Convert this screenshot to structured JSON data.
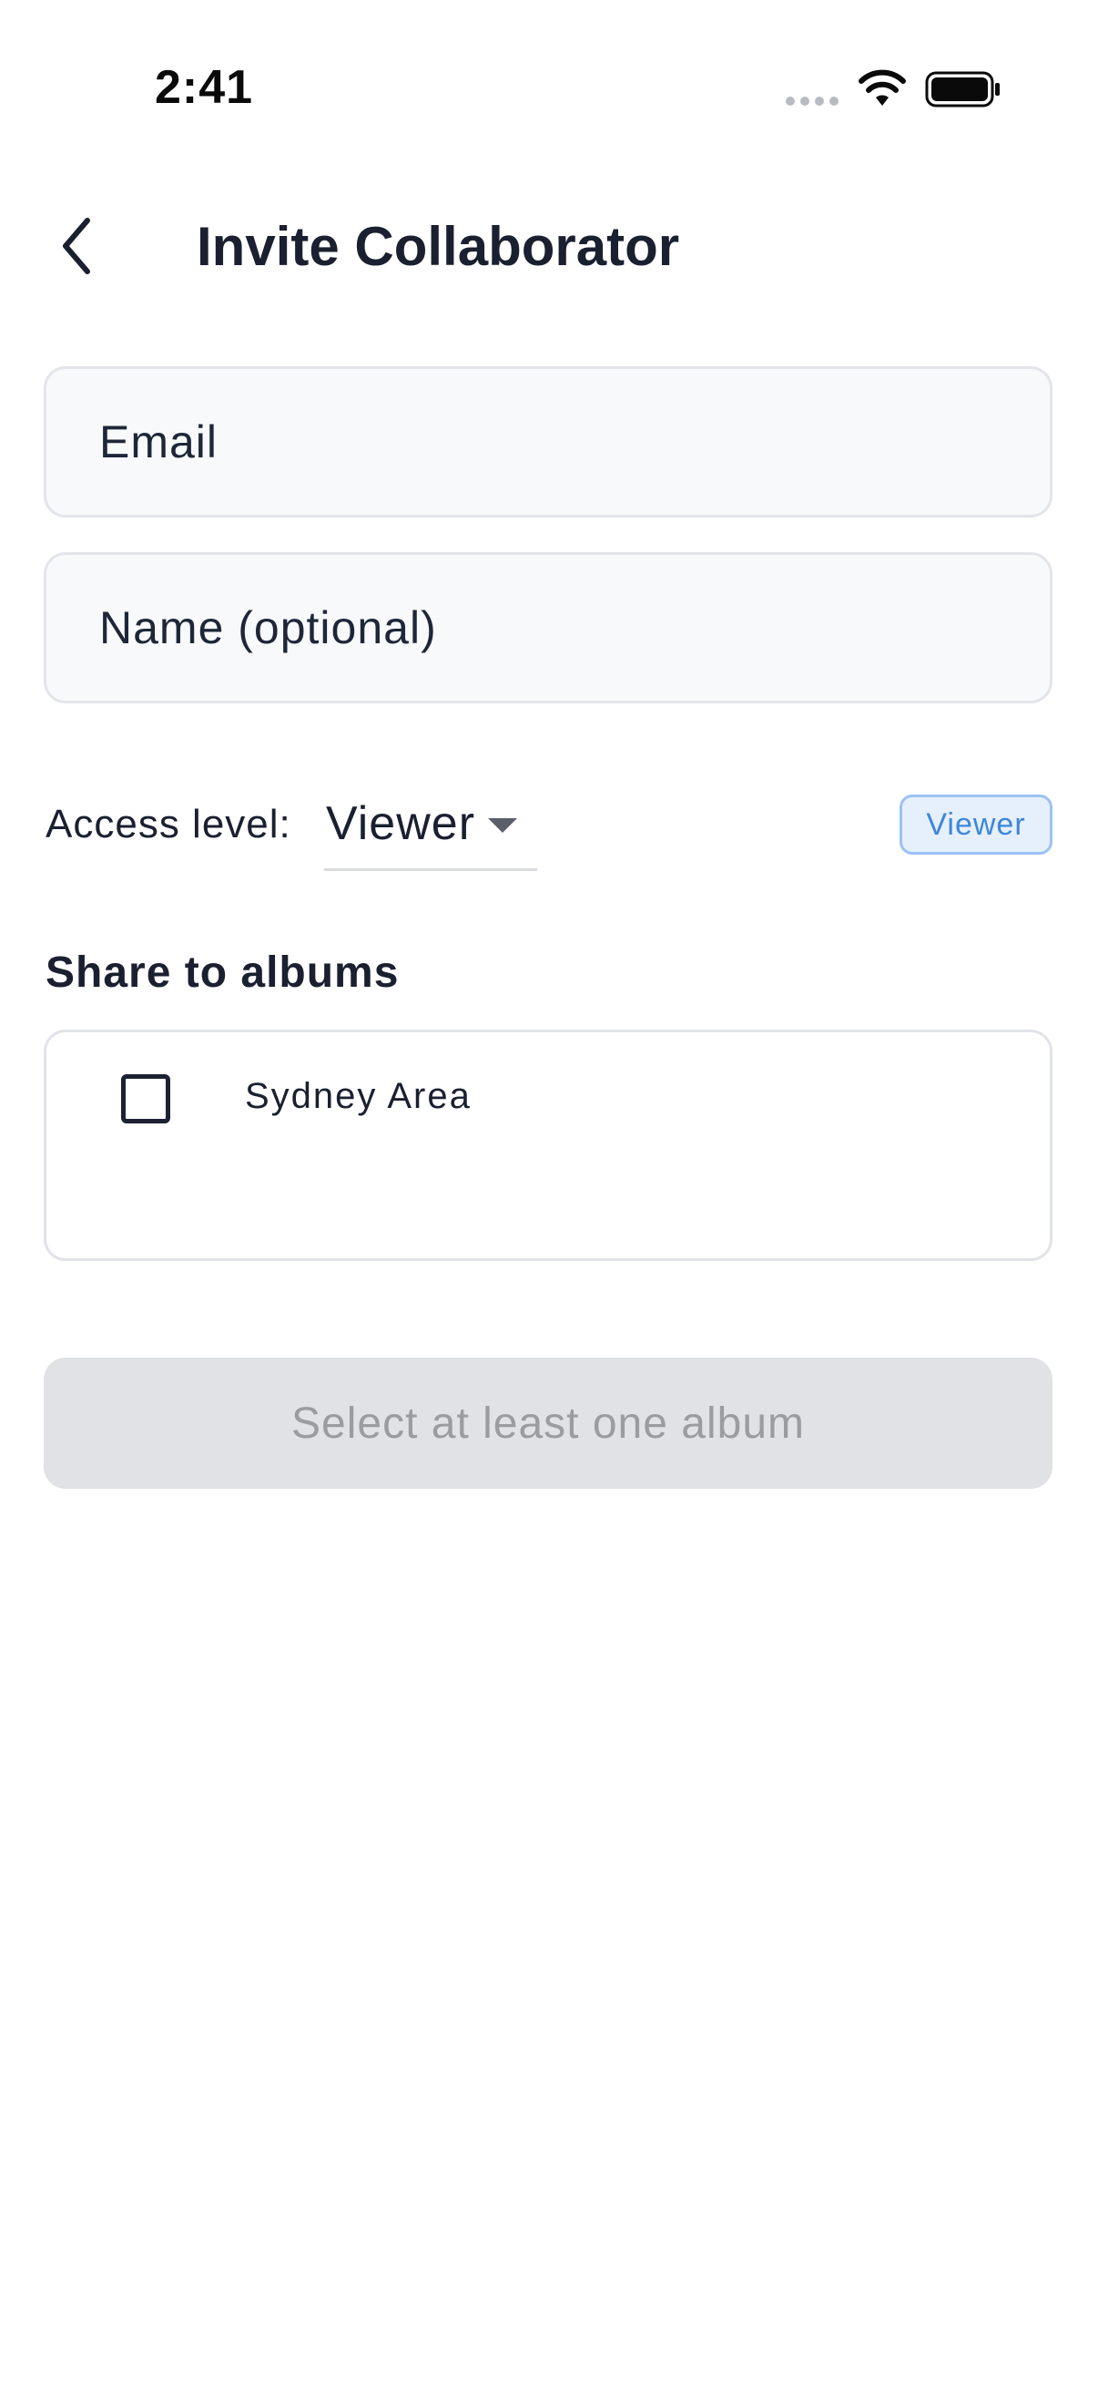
{
  "status_bar": {
    "time": "2:41",
    "icons": [
      "cellular-signal-icon",
      "wifi-icon",
      "battery-icon"
    ]
  },
  "header": {
    "back_icon": "chevron-left-icon",
    "title": "Invite Collaborator"
  },
  "form": {
    "email": {
      "placeholder": "Email",
      "value": ""
    },
    "name": {
      "placeholder": "Name (optional)",
      "value": ""
    },
    "access_level": {
      "label": "Access level:",
      "selected": "Viewer",
      "badge": "Viewer"
    },
    "albums": {
      "heading": "Share to albums",
      "items": [
        {
          "label": "Sydney Area",
          "checked": false
        }
      ]
    },
    "submit": {
      "label": "Select at least one album",
      "disabled": true
    }
  },
  "colors": {
    "text_primary": "#1a2030",
    "field_background": "#f8f9fb",
    "field_border": "#e3e5ea",
    "badge_background": "#e6f0fd",
    "badge_border": "#9cc2f2",
    "badge_text": "#3d86db",
    "disabled_button_background": "#e1e2e5",
    "disabled_button_text": "#9a9ca2"
  }
}
